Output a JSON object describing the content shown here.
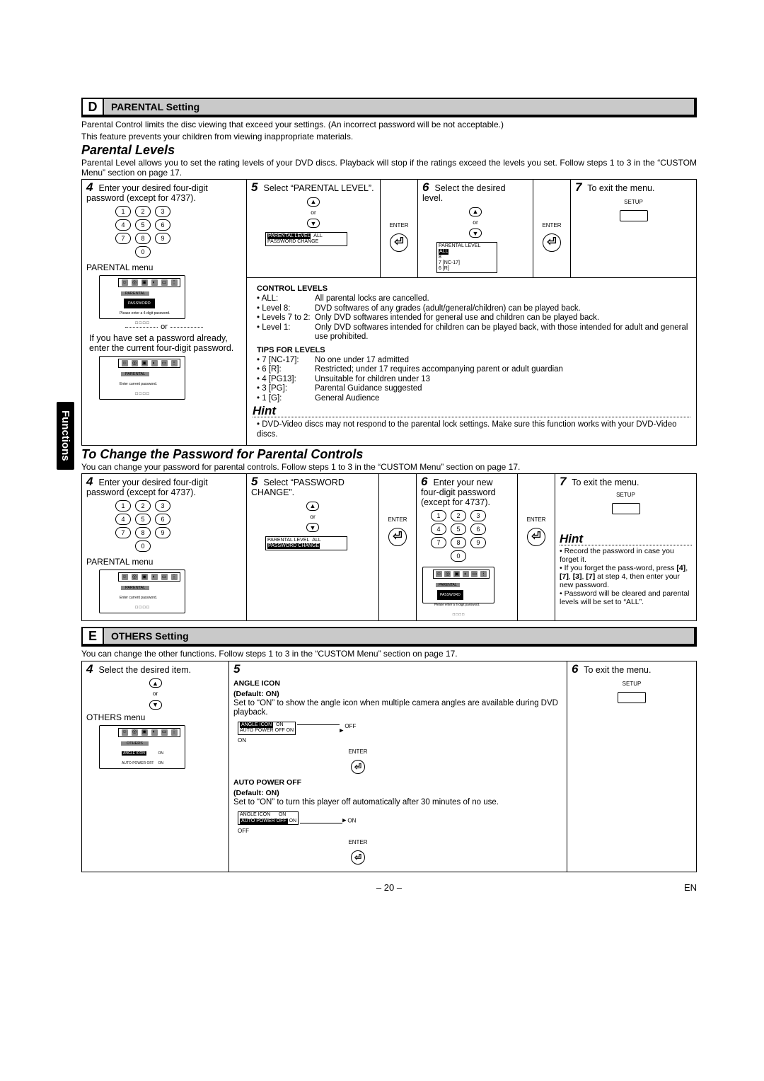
{
  "sidebar": {
    "label": "Functions"
  },
  "sections": {
    "d": {
      "letter": "D",
      "title": "PARENTAL Setting"
    },
    "e": {
      "letter": "E",
      "title": "OTHERS Setting"
    }
  },
  "intro_d_l1": "Parental Control limits the disc viewing that exceed your settings. (An incorrect password will be not acceptable.)",
  "intro_d_l2": "This feature prevents your children from viewing inappropriate materials.",
  "parental_levels_head": "Parental Levels",
  "parental_levels_intro": "Parental Level allows you to set the rating levels of your DVD discs. Playback will stop if the ratings exceed the levels you set. Follow steps 1 to 3 in the “CUSTOM Menu” section on page 17.",
  "pl": {
    "s4": {
      "n": "4",
      "txt": "Enter your desired four-digit password (except for 4737).",
      "menu": "PARENTAL menu"
    },
    "already": "If you have set a password already, enter the current four-digit password.",
    "or": "or",
    "s5": {
      "n": "5",
      "txt": "Select “PARENTAL LEVEL”.",
      "enter": "ENTER"
    },
    "s6": {
      "n": "6",
      "txt": "Select the desired level.",
      "enter": "ENTER"
    },
    "s7": {
      "n": "7",
      "txt": "To exit the menu.",
      "setup": "SETUP"
    },
    "lvlbox1": {
      "a": "PARENTAL LEVEL",
      "b": "PASSWORD CHANGE",
      "c": "ALL"
    },
    "lvlbox2": {
      "a": "PARENTAL LEVEL",
      "b": "ALL",
      "c": "8",
      "d": "7 [NC-17]",
      "e": "6 [R]"
    }
  },
  "control_levels": {
    "head": "CONTROL LEVELS",
    "rows": [
      {
        "k": "• ALL:",
        "v": "All parental locks are cancelled."
      },
      {
        "k": "• Level 8:",
        "v": "DVD softwares of any grades (adult/general/children) can be played back."
      },
      {
        "k": "• Levels 7 to 2:",
        "v": "Only DVD softwares intended for general use and children can be played back."
      },
      {
        "k": "• Level 1:",
        "v": "Only DVD softwares intended for children can be played back, with those intended for adult and general use prohibited."
      }
    ]
  },
  "tips": {
    "head": "TIPS FOR LEVELS",
    "rows": [
      {
        "k": "• 7 [NC-17]:",
        "v": "No one under 17 admitted"
      },
      {
        "k": "• 6 [R]:",
        "v": "Restricted; under 17 requires accompanying parent or adult guardian"
      },
      {
        "k": "• 4 [PG13]:",
        "v": "Unsuitable for children under 13"
      },
      {
        "k": "• 3 [PG]:",
        "v": "Parental Guidance suggested"
      },
      {
        "k": "• 1 [G]:",
        "v": "General Audience"
      }
    ]
  },
  "hint1": {
    "head": "Hint",
    "body": "DVD-Video discs may not respond to the parental lock settings. Make sure this function works with your DVD-Video discs."
  },
  "change_pw_head": "To Change the Password for Parental Controls",
  "change_pw_intro": "You can change your password for parental controls. Follow steps 1 to 3 in the “CUSTOM Menu” section on page 17.",
  "cp": {
    "s4": {
      "n": "4",
      "txt": "Enter your desired four-digit password (except for 4737).",
      "menu": "PARENTAL menu"
    },
    "s5": {
      "n": "5",
      "txt": "Select “PASSWORD CHANGE”.",
      "enter": "ENTER"
    },
    "s6": {
      "n": "6",
      "txt": "Enter your new four-digit password (except for 4737).",
      "enter": "ENTER"
    },
    "s7": {
      "n": "7",
      "txt": "To exit the menu.",
      "setup": "SETUP"
    },
    "lvlbox": {
      "a": "PARENTAL LEVEL",
      "b": "PASSWORD CHANGE",
      "c": "ALL"
    }
  },
  "hint2": {
    "head": "Hint",
    "items": [
      "Record the password in case you forget it.",
      "If you forget the pass-word, press [4], [7], [3], [7] at step 4, then enter your new password.",
      "Password will be cleared and parental levels will be set to “ALL”."
    ],
    "bolds": [
      "[4]",
      "[7]",
      "[3]",
      "[7]"
    ]
  },
  "intro_e": "You can change the other functions. Follow steps 1 to 3 in the “CUSTOM Menu” section on page 17.",
  "oth": {
    "s4": {
      "n": "4",
      "txt": "Select the desired item.",
      "menu": "OTHERS menu"
    },
    "s5": {
      "n": "5",
      "angle": {
        "head": "ANGLE ICON",
        "def": "(Default: ON)",
        "body": "Set to “ON” to show the angle icon when multiple camera angles are available during DVD playback."
      },
      "auto": {
        "head": "AUTO POWER OFF",
        "def": "(Default: ON)",
        "body": "Set to “ON” to turn this player off automatically after 30 minutes of no use."
      },
      "tbl1a": "ANGLE ICON",
      "tbl1b": "ON",
      "tbl1c": "AUTO POWER OFF",
      "tbl1d": "ON",
      "arr1a": "OFF",
      "arr1b": "ON",
      "enter": "ENTER",
      "arr2a": "ON",
      "arr2b": "OFF"
    },
    "s6": {
      "n": "6",
      "txt": "To exit the menu.",
      "setup": "SETUP"
    }
  },
  "tvbox": {
    "parental_lbl": "PARENTAL",
    "password_lbl": "PASSWORD",
    "prompt": "Please enter a 4-digit password.",
    "curprompt": "Enter current password.",
    "boxes": "□ □ □ □",
    "others_lbl": "OTHERS",
    "ai": "ANGLE ICON",
    "ai_v": "ON",
    "ap": "AUTO POWER OFF",
    "ap_v": "ON"
  },
  "keypad": [
    [
      "1",
      "2",
      "3"
    ],
    [
      "4",
      "5",
      "6"
    ],
    [
      "7",
      "8",
      "9"
    ],
    [
      "0"
    ]
  ],
  "footer": {
    "page": "– 20 –",
    "lang": "EN"
  }
}
